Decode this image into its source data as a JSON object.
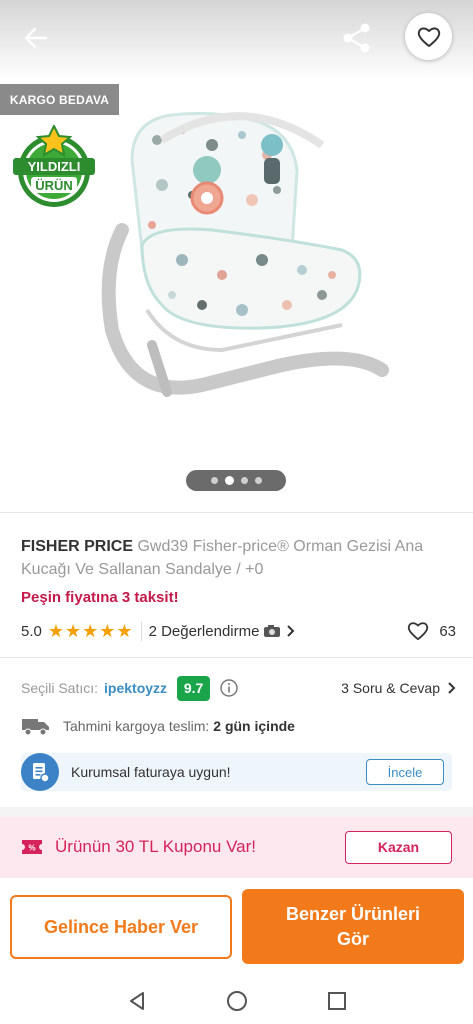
{
  "gallery": {
    "cargo_badge": "KARGO BEDAVA",
    "star_badge_line1": "YILDIZLI",
    "star_badge_line2": "ÜRÜN",
    "image_count": 4,
    "active_image": 2
  },
  "product": {
    "brand": "FISHER PRICE",
    "name": "Gwd39 Fisher-price® Orman Gezisi Ana Kucağı Ve Sallanan Sandalye / +0",
    "installment": "Peşin fiyatına 3 taksit!",
    "rating_score": "5.0",
    "rating_stars": 5,
    "reviews_text": "2 Değerlendirme",
    "favorite_count": "63"
  },
  "seller": {
    "label": "Seçili Satıcı:",
    "name": "ipektoyzz",
    "score": "9.7",
    "qa_link": "3 Soru & Cevap",
    "shipping_label": "Tahmini kargoya teslim:",
    "shipping_value": "2 gün içinde",
    "invoice_text": "Kurumsal faturaya uygun!",
    "invoice_button": "İncele"
  },
  "coupon": {
    "text": "Ürünün 30 TL Kuponu Var!",
    "button": "Kazan"
  },
  "actions": {
    "notify_button": "Gelince Haber Ver",
    "similar_button": "Benzer Ürünleri Gör"
  },
  "colors": {
    "accent_orange": "#f27a1a",
    "coupon_pink": "#d4245b",
    "seller_blue": "#3a8ec4",
    "score_green": "#1ba54a",
    "star_yellow": "#f5a000"
  }
}
